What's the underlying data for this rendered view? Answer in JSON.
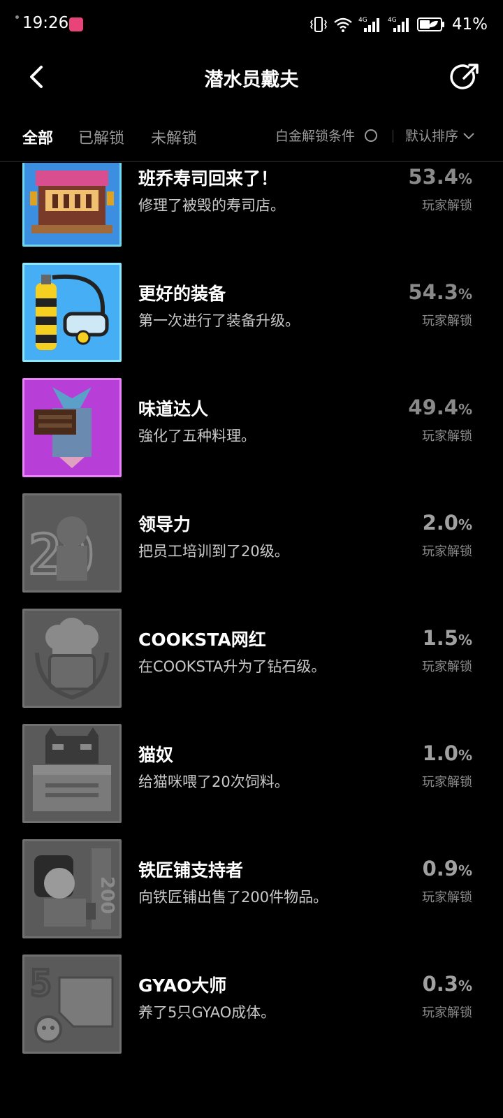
{
  "status_bar": {
    "time": "19:26",
    "battery": "41%",
    "net1": "4G",
    "net2": "4G"
  },
  "header": {
    "title": "潜水员戴夫"
  },
  "tabs": {
    "all": "全部",
    "unlocked": "已解锁",
    "locked": "未解锁",
    "platinum_condition": "白金解锁条件",
    "sort": "默认排序"
  },
  "achievements": [
    {
      "title": "班乔寿司回来了！",
      "desc": "修理了被毁的寿司店。",
      "pct": "53.4",
      "pct_sym": "%",
      "unlock_label": "玩家解锁",
      "icon": "sushi-shop-icon",
      "locked": false,
      "colors": {
        "bg": "#3b8ee0",
        "border": "#6fd6f0"
      }
    },
    {
      "title": "更好的装备",
      "desc": "第一次进行了装备升级。",
      "pct": "54.3",
      "pct_sym": "%",
      "unlock_label": "玩家解锁",
      "icon": "oxygen-tank-icon",
      "locked": false,
      "colors": {
        "bg": "#45aef5",
        "border": "#8fe6ff"
      }
    },
    {
      "title": "味道达人",
      "desc": "強化了五种料理。",
      "pct": "49.4",
      "pct_sym": "%",
      "unlock_label": "玩家解锁",
      "icon": "fish-dish-icon",
      "locked": false,
      "colors": {
        "bg": "#b83ed8",
        "border": "#e884f5"
      }
    },
    {
      "title": "领导力",
      "desc": "把员工培训到了20级。",
      "pct": "2.0",
      "pct_sym": "%",
      "unlock_label": "玩家解锁",
      "icon": "level-20-staff-icon",
      "locked": true,
      "colors": {
        "bg": "#5a5a5a",
        "border": "#707070"
      }
    },
    {
      "title": "COOKSTA网红",
      "desc": "在COOKSTA升为了钻石级。",
      "pct": "1.5",
      "pct_sym": "%",
      "unlock_label": "玩家解锁",
      "icon": "chef-hat-icon",
      "locked": true,
      "colors": {
        "bg": "#5a5a5a",
        "border": "#707070"
      }
    },
    {
      "title": "猫奴",
      "desc": "给猫咪喂了20次饲料。",
      "pct": "1.0",
      "pct_sym": "%",
      "unlock_label": "玩家解锁",
      "icon": "cat-box-icon",
      "locked": true,
      "colors": {
        "bg": "#5a5a5a",
        "border": "#707070"
      }
    },
    {
      "title": "铁匠铺支持者",
      "desc": "向铁匠铺出售了200件物品。",
      "pct": "0.9",
      "pct_sym": "%",
      "unlock_label": "玩家解锁",
      "icon": "blacksmith-icon",
      "locked": true,
      "colors": {
        "bg": "#5a5a5a",
        "border": "#707070"
      }
    },
    {
      "title": "GYAO大师",
      "desc": "养了5只GYAO成体。",
      "pct": "0.3",
      "pct_sym": "%",
      "unlock_label": "玩家解锁",
      "icon": "gyao-creature-icon",
      "locked": true,
      "colors": {
        "bg": "#5a5a5a",
        "border": "#707070"
      }
    }
  ]
}
